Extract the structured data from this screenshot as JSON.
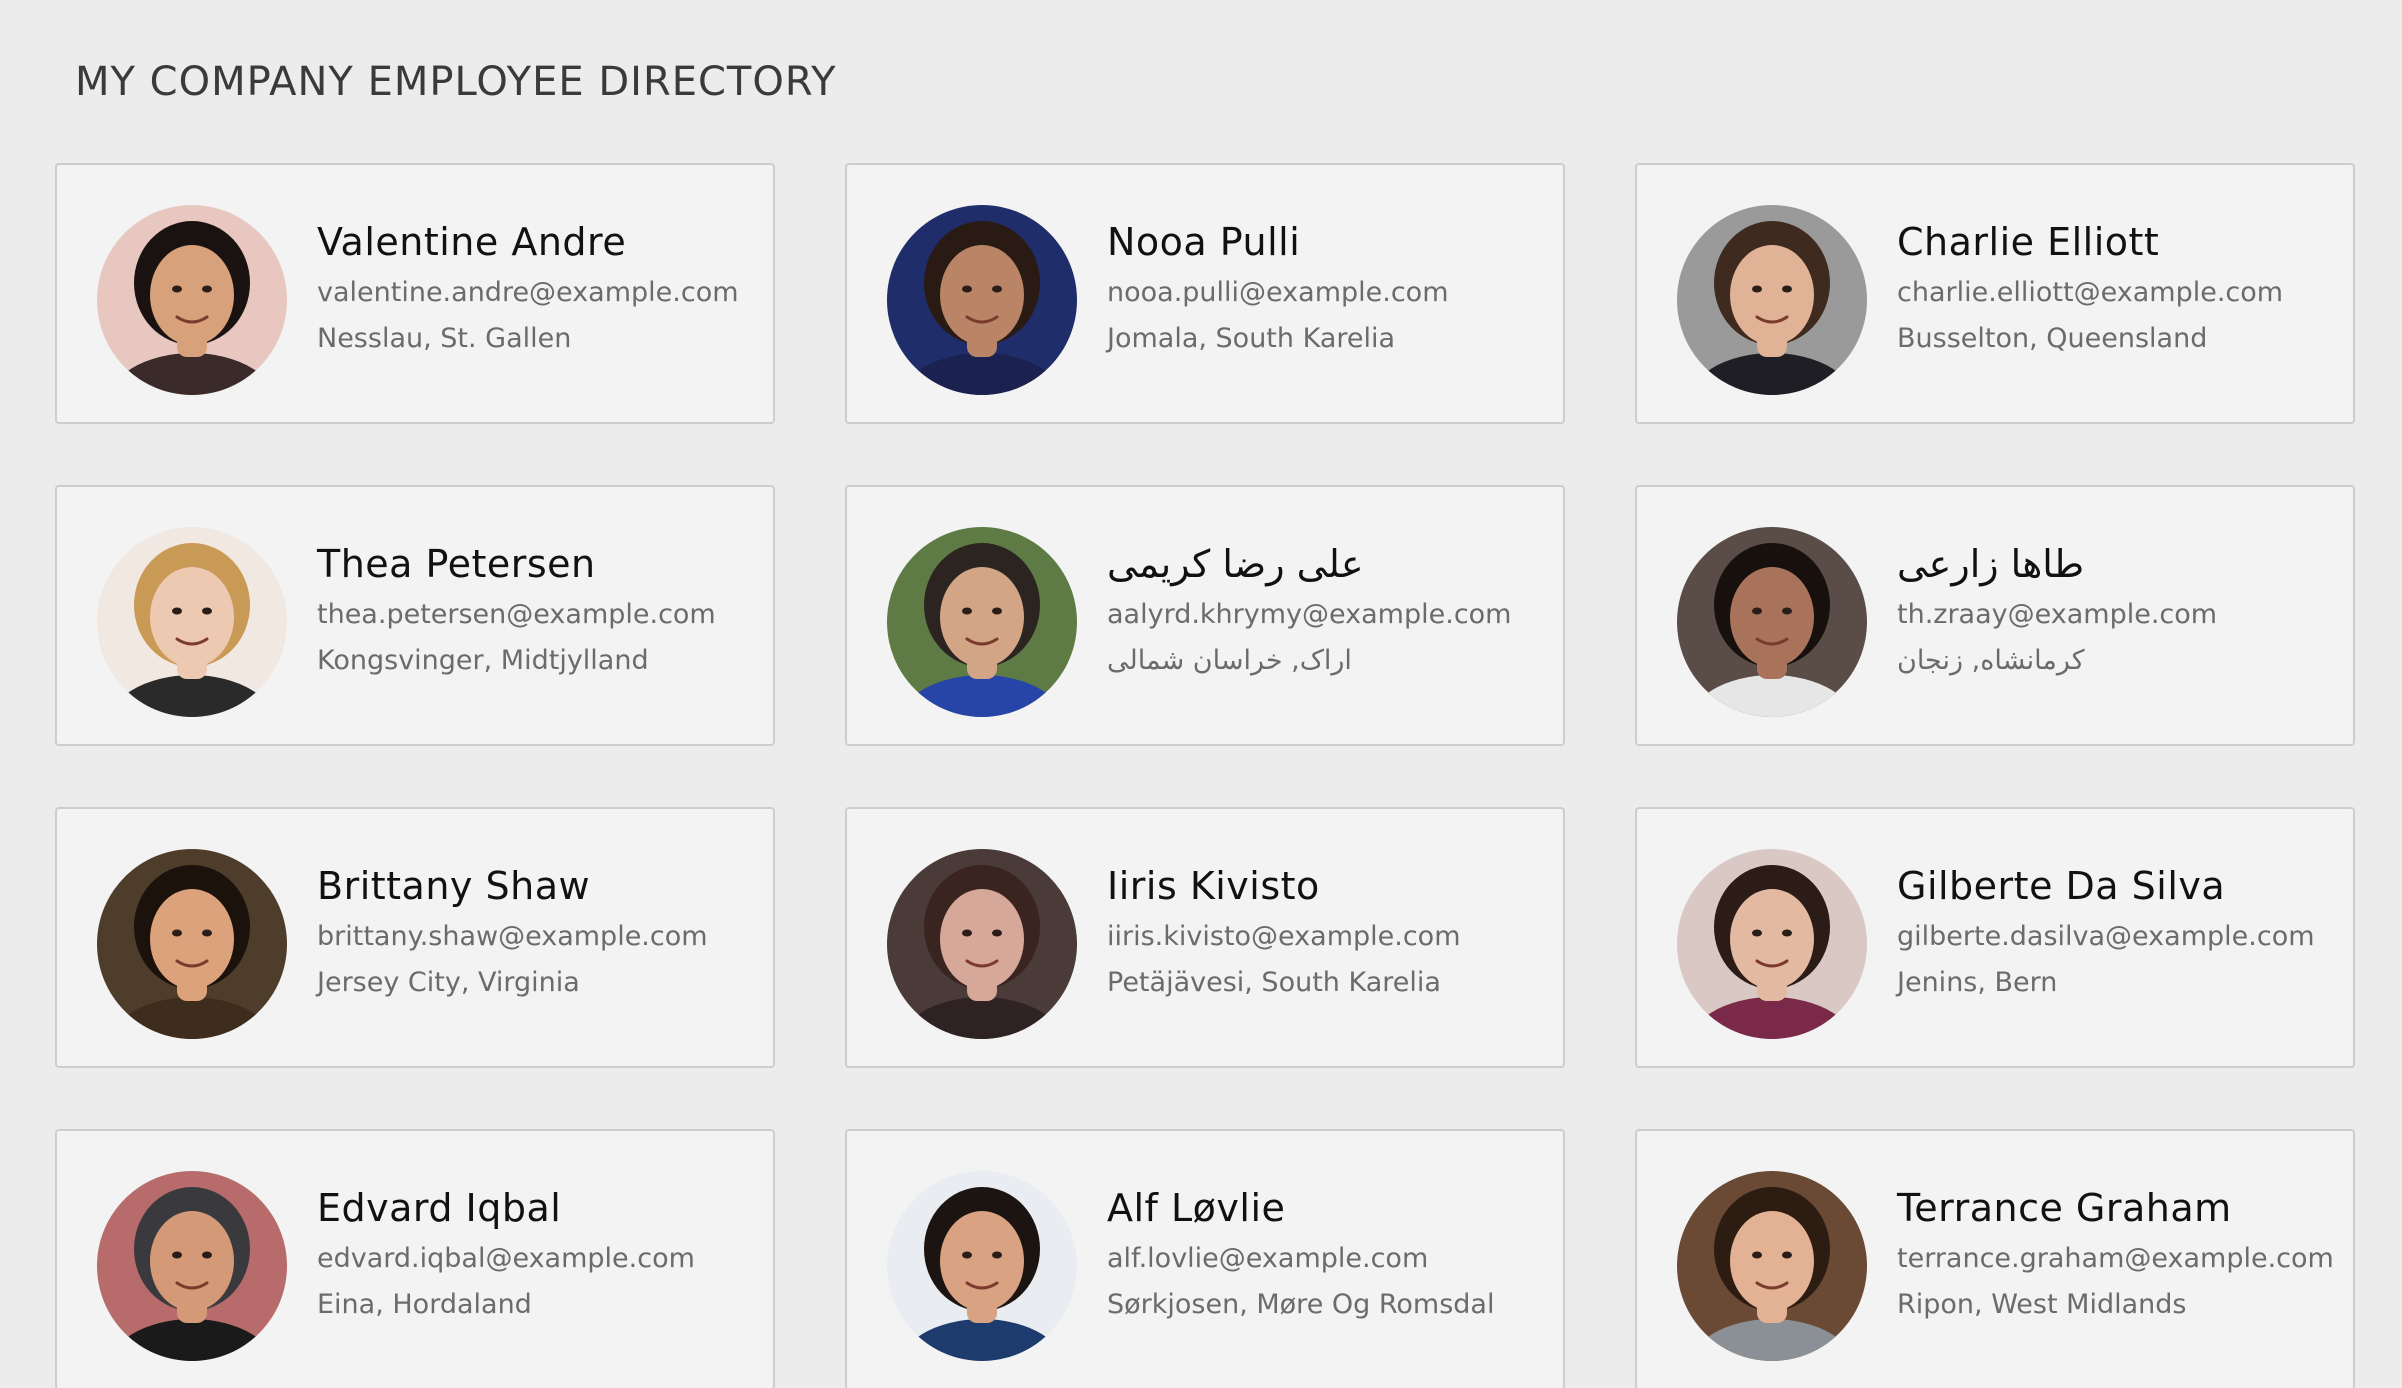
{
  "page": {
    "title": "MY COMPANY EMPLOYEE DIRECTORY"
  },
  "employees": [
    {
      "name": "Valentine Andre",
      "email": "valentine.andre@example.com",
      "location": "Nesslau, St. Gallen",
      "avatar": {
        "bg": "#e8c7c0",
        "skin": "#d7a17c",
        "hair": "#1a1210",
        "shirt": "#3b2a2a"
      }
    },
    {
      "name": "Nooa Pulli",
      "email": "nooa.pulli@example.com",
      "location": "Jomala, South Karelia",
      "avatar": {
        "bg": "#1f2d6b",
        "skin": "#b98566",
        "hair": "#2a1a14",
        "shirt": "#1b2250"
      }
    },
    {
      "name": "Charlie Elliott",
      "email": "charlie.elliott@example.com",
      "location": "Busselton, Queensland",
      "avatar": {
        "bg": "#9a9a9a",
        "skin": "#e0b397",
        "hair": "#3e2a1e",
        "shirt": "#1e1e24"
      }
    },
    {
      "name": "Thea Petersen",
      "email": "thea.petersen@example.com",
      "location": "Kongsvinger, Midtjylland",
      "avatar": {
        "bg": "#f1e8e2",
        "skin": "#eec9b1",
        "hair": "#c99a55",
        "shirt": "#2a2a2a"
      }
    },
    {
      "name": "علی رضا کریمی",
      "email": "aalyrd.khrymy@example.com",
      "location": "اراک, خراسان شمالی",
      "avatar": {
        "bg": "#5e7a45",
        "skin": "#d2a586",
        "hair": "#2c2420",
        "shirt": "#2744a8"
      }
    },
    {
      "name": "طاها زارعی",
      "email": "th.zraay@example.com",
      "location": "کرمانشاه, زنجان",
      "avatar": {
        "bg": "#5a4d48",
        "skin": "#a8735a",
        "hair": "#18100c",
        "shirt": "#e6e6e6"
      }
    },
    {
      "name": "Brittany Shaw",
      "email": "brittany.shaw@example.com",
      "location": "Jersey City, Virginia",
      "avatar": {
        "bg": "#4e3d2a",
        "skin": "#dba27c",
        "hair": "#1c120c",
        "shirt": "#3e2c1c"
      }
    },
    {
      "name": "Iiris Kivisto",
      "email": "iiris.kivisto@example.com",
      "location": "Petäjävesi, South Karelia",
      "avatar": {
        "bg": "#4a3a38",
        "skin": "#d6a89a",
        "hair": "#3a2420",
        "shirt": "#2e2222"
      }
    },
    {
      "name": "Gilberte Da Silva",
      "email": "gilberte.dasilva@example.com",
      "location": "Jenins, Bern",
      "avatar": {
        "bg": "#d9c8c4",
        "skin": "#e4b9a2",
        "hair": "#2c1c18",
        "shirt": "#7a2a48"
      }
    },
    {
      "name": "Edvard Iqbal",
      "email": "edvard.iqbal@example.com",
      "location": "Eina, Hordaland",
      "avatar": {
        "bg": "#b86b6b",
        "skin": "#d49a78",
        "hair": "#3a3a3e",
        "shirt": "#1a1a1a"
      }
    },
    {
      "name": "Alf Løvlie",
      "email": "alf.lovlie@example.com",
      "location": "Sørkjosen, Møre Og Romsdal",
      "avatar": {
        "bg": "#e9edf2",
        "skin": "#d9a282",
        "hair": "#1c1410",
        "shirt": "#1e3b6e"
      }
    },
    {
      "name": "Terrance Graham",
      "email": "terrance.graham@example.com",
      "location": "Ripon, West Midlands",
      "avatar": {
        "bg": "#6a4a34",
        "skin": "#e3b294",
        "hair": "#2c1c12",
        "shirt": "#8b8f96"
      }
    }
  ]
}
